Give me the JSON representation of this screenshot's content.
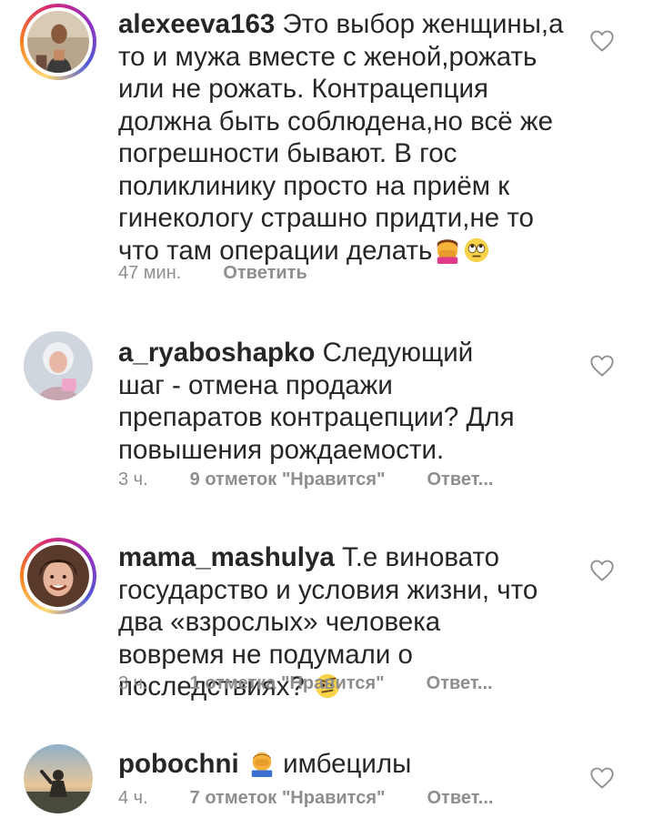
{
  "comments": [
    {
      "username": "alexeeva163",
      "text": "Это выбор женщины,а то и мужа вместе с женой,рожать или не рожать. Контрацепция должна быть соблюдена,но всё же погрешности бывают. В гос поликлинику просто на приём к гинекологу страшно придти,не то что там операции делать",
      "emoji": [
        "facepalm-woman-emoji",
        "eye-roll-emoji"
      ],
      "time": "47 мин.",
      "likes": "",
      "reply": "Ответить"
    },
    {
      "username": "a_ryaboshapko",
      "text": "Следующий шаг - отмена продажи препаратов контрацепции? Для повышения рождаемости.",
      "emoji": [],
      "time": "3 ч.",
      "likes": "9 отметок \"Нравится\"",
      "reply": "Ответ..."
    },
    {
      "username": "mama_mashulya",
      "text": "Т.е виновато государство и условия жизни, что два «взрослых» человека вовремя не подумали о последствиях?",
      "emoji": [
        "raised-eyebrow-emoji"
      ],
      "time": "3 ч.",
      "likes": "1 отметка \"Нравится\"",
      "reply": "Ответ..."
    },
    {
      "username": "pobochni",
      "text": "имбецилы",
      "emoji": [
        "facepalm-man-emoji"
      ],
      "time": "4 ч.",
      "likes": "7 отметок \"Нравится\"",
      "reply": "Ответ..."
    }
  ],
  "colors": {
    "text": "#262626",
    "meta": "#8e8e8e",
    "heart": "#8e8e8e"
  },
  "icons": {
    "like": "heart-outline-icon"
  }
}
